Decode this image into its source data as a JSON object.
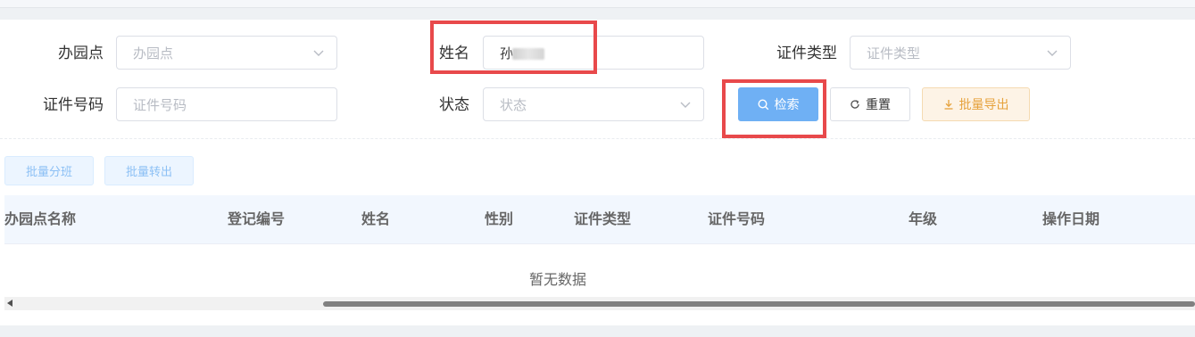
{
  "filters": {
    "campus": {
      "label": "办园点",
      "placeholder": "办园点"
    },
    "name": {
      "label": "姓名",
      "value": "孙"
    },
    "id_type": {
      "label": "证件类型",
      "placeholder": "证件类型"
    },
    "id_number": {
      "label": "证件号码",
      "placeholder": "证件号码"
    },
    "status": {
      "label": "状态",
      "placeholder": "状态"
    }
  },
  "buttons": {
    "search": "检索",
    "reset": "重置",
    "batch_export": "批量导出",
    "batch_assign_class": "批量分班",
    "batch_transfer_out": "批量转出"
  },
  "table": {
    "columns": [
      "办园点名称",
      "登记编号",
      "姓名",
      "性别",
      "证件类型",
      "证件号码",
      "年级",
      "操作日期"
    ],
    "empty_text": "暂无数据"
  },
  "icons": {
    "search": "search-icon",
    "reset": "refresh-icon",
    "export": "download-icon",
    "dropdown": "chevron-down-icon"
  },
  "colors": {
    "primary": "#6fb0f4",
    "warning": "#e6a23c",
    "highlight": "#e8494b"
  }
}
